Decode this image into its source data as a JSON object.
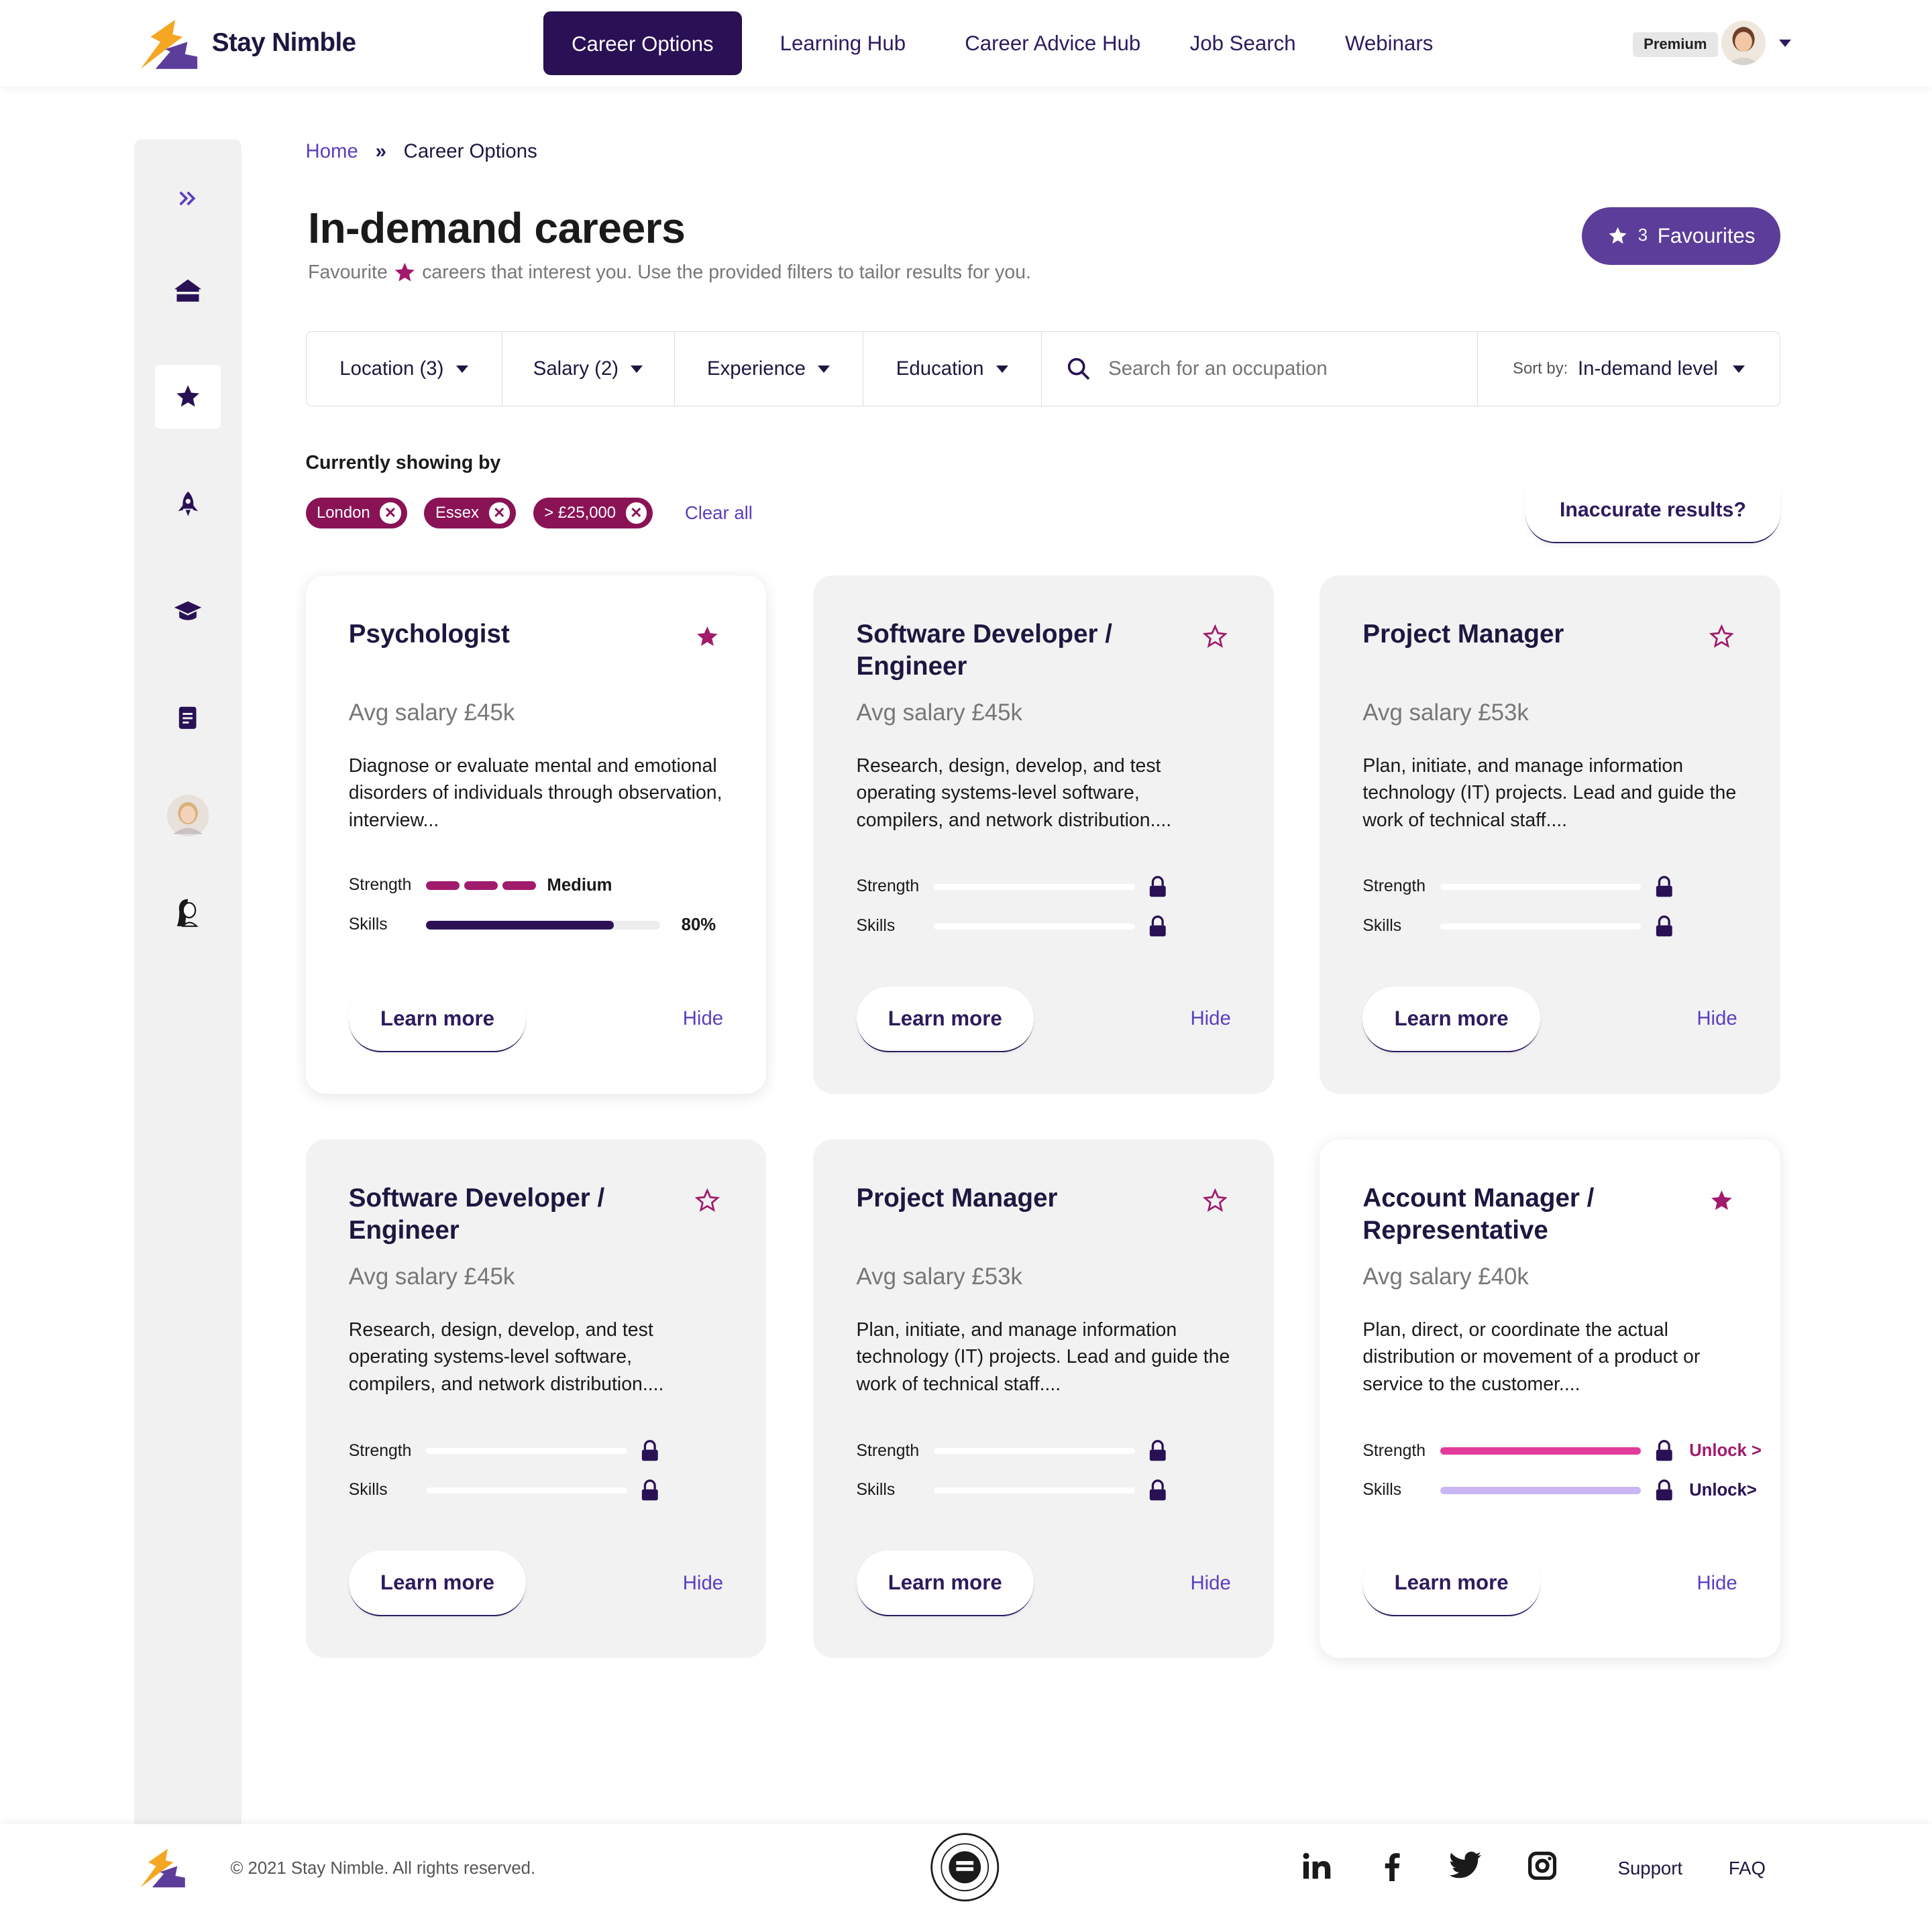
{
  "brand": {
    "name": "Stay Nimble"
  },
  "nav": {
    "items": [
      "Career Options",
      "Learning Hub",
      "Career Advice Hub",
      "Job Search",
      "Webinars"
    ],
    "active": "Career Options"
  },
  "user": {
    "plan_badge": "Premium"
  },
  "breadcrumb": {
    "home": "Home",
    "separator": "»",
    "current": "Career Options"
  },
  "page": {
    "title": "In-demand careers",
    "subtitle_before": "Favourite",
    "subtitle_after": "careers that interest you. Use the provided filters to tailor results for you.",
    "favourites_count": "3",
    "favourites_label": "Favourites"
  },
  "filters": {
    "location": "Location (3)",
    "salary": "Salary (2)",
    "experience": "Experience",
    "education": "Education",
    "search_placeholder": "Search for an occupation",
    "sort_label": "Sort by:",
    "sort_value": "In-demand level"
  },
  "showing": {
    "label": "Currently showing by",
    "chips": [
      "London",
      "Essex",
      "> £25,000"
    ],
    "clear": "Clear all",
    "inaccurate": "Inaccurate results?"
  },
  "cards": [
    {
      "title": "Psychologist",
      "salary": "Avg salary £45k",
      "desc": "Diagnose or evaluate mental and emotional disorders of individuals through observation, interview...",
      "favourited": true,
      "strength_label": "Strength",
      "skills_label": "Skills",
      "strength_value": "Medium",
      "skills_value": "80%",
      "skills_pct": 0.8,
      "learn": "Learn more",
      "hide": "Hide"
    },
    {
      "title": "Software Developer / Engineer",
      "salary": "Avg salary £45k",
      "desc": "Research, design, develop, and test operating systems-level software, compilers, and network distribution....",
      "favourited": false,
      "strength_label": "Strength",
      "skills_label": "Skills",
      "learn": "Learn more",
      "hide": "Hide"
    },
    {
      "title": "Project Manager",
      "salary": "Avg salary £53k",
      "desc": "Plan, initiate, and manage information technology (IT) projects. Lead and guide the work of technical staff....",
      "favourited": false,
      "strength_label": "Strength",
      "skills_label": "Skills",
      "learn": "Learn more",
      "hide": "Hide"
    },
    {
      "title": "Software Developer / Engineer",
      "salary": "Avg salary £45k",
      "desc": "Research, design, develop, and test operating systems-level software, compilers, and network distribution....",
      "favourited": false,
      "strength_label": "Strength",
      "skills_label": "Skills",
      "learn": "Learn more",
      "hide": "Hide"
    },
    {
      "title": "Project Manager",
      "salary": "Avg salary £53k",
      "desc": "Plan, initiate, and manage information technology (IT) projects. Lead and guide the work of technical staff....",
      "favourited": false,
      "strength_label": "Strength",
      "skills_label": "Skills",
      "learn": "Learn more",
      "hide": "Hide"
    },
    {
      "title": "Account Manager / Representative",
      "salary": "Avg salary £40k",
      "desc": "Plan, direct, or coordinate the actual distribution or movement of a product or service to the customer....",
      "favourited": true,
      "strength_label": "Strength",
      "skills_label": "Skills",
      "strength_unlock": "Unlock >",
      "skills_unlock": "Unlock>",
      "learn": "Learn more",
      "hide": "Hide"
    }
  ],
  "footer": {
    "copyright": "© 2021 Stay Nimble. All rights reserved.",
    "support": "Support",
    "faq": "FAQ"
  },
  "colors": {
    "brand_dark": "#2a1155",
    "accent_purple": "#5c3d9a",
    "link_purple": "#5b3fc0",
    "chip_magenta": "#8a1356",
    "star_magenta": "#a11b6d",
    "unlock_pink": "#e23b9a",
    "unlock_lilac": "#c9b6f2"
  }
}
